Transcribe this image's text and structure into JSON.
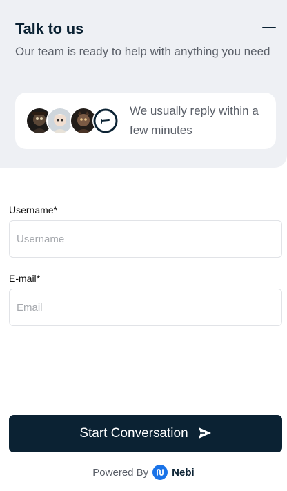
{
  "header": {
    "title": "Talk to us",
    "subtitle": "Our team is ready to help with anything you need",
    "minimize_icon": "minimize-icon",
    "background": "#eef0f4"
  },
  "reply_card": {
    "text": "We usually reply within a few minutes",
    "avatars": [
      "agent-avatar-1",
      "agent-avatar-2",
      "agent-avatar-3",
      "agent-avatar-4"
    ]
  },
  "form": {
    "username": {
      "label": "Username*",
      "placeholder": "Username",
      "value": ""
    },
    "email": {
      "label": "E-mail*",
      "placeholder": "Email",
      "value": ""
    }
  },
  "cta": {
    "label": "Start Conversation",
    "icon": "send-icon",
    "color": "#0b2233"
  },
  "footer": {
    "powered_by": "Powered By",
    "brand": "Nebi",
    "brand_color": "#1a73e8"
  }
}
